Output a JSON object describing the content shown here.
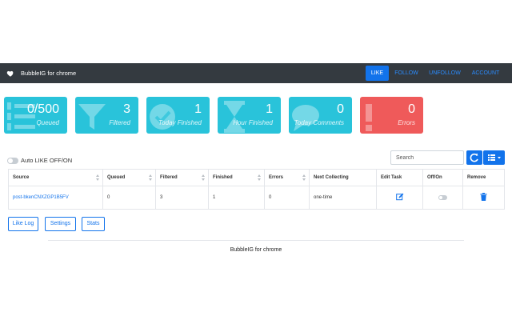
{
  "app": {
    "title": "BubbleIG for chrome"
  },
  "nav": {
    "like": "LIKE",
    "follow": "FOLLOW",
    "unfollow": "UNFOLLOW",
    "account": "ACCOUNT"
  },
  "stats": {
    "queued": {
      "value": "0/500",
      "label": "Queued"
    },
    "filtered": {
      "value": "3",
      "label": "Filtered"
    },
    "today_finished": {
      "value": "1",
      "label": "Today Finished"
    },
    "hour_finished": {
      "value": "1",
      "label": "Hour Finished"
    },
    "today_comments": {
      "value": "0",
      "label": "Today Comments"
    },
    "errors": {
      "value": "0",
      "label": "Errors"
    }
  },
  "auto_like": {
    "label": "Auto LIKE OFF/ON",
    "enabled": false
  },
  "search": {
    "placeholder": "Search"
  },
  "table": {
    "headers": [
      "Source",
      "Queued",
      "Filtered",
      "Finished",
      "Errors",
      "Next Collecting",
      "Edit Task",
      "Off/On",
      "Remove"
    ],
    "rows": [
      {
        "source": "post-bkenCNXZGP1B5FV",
        "queued": "0",
        "filtered": "3",
        "finished": "1",
        "errors": "0",
        "next_collecting": "one-time",
        "enabled": false
      }
    ]
  },
  "buttons": {
    "like_log": "Like Log",
    "settings": "Settings",
    "stats": "Stats"
  },
  "footer": {
    "text": "BubbleIG for chrome"
  },
  "colors": {
    "navbar": "#343a40",
    "accent": "#1273eb",
    "card": "#29c3da",
    "error_card": "#ef5a5a"
  }
}
